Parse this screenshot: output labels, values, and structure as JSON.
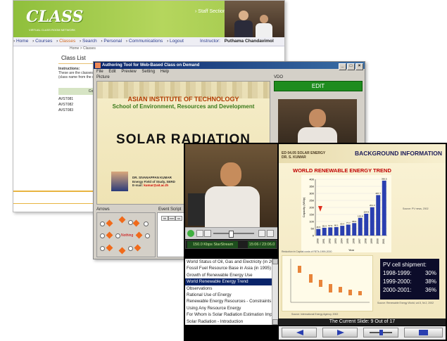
{
  "vclass": {
    "logo": "CLASS",
    "logo_sub": "VIRTUAL CLASS ROOM NETWORK",
    "staff_section": "Staff Section",
    "nav": [
      "Home",
      "Courses",
      "Classes",
      "Search",
      "Personal",
      "Communications",
      "Logout"
    ],
    "active_nav": "Classes",
    "instructor_label": "Instructor:",
    "instructor_name": "Puthama Chandavimol",
    "breadcrumb": "Home > Classes",
    "class_list": "Class List",
    "instructions_label": "Instructions:",
    "instructions_text": [
      "These are the classes ass",
      "(class name from the dro"
    ],
    "course_header": "Course No.",
    "courses": [
      "AVST081",
      "AVST082",
      "AVST083"
    ]
  },
  "authoring": {
    "title": "Authoring Tool for Web-Based Class on Demand",
    "menu": [
      "File",
      "Edit",
      "Preview",
      "Setting",
      "Help"
    ],
    "picture_label": "Picture",
    "vdo_label": "VDO",
    "edit_button": "EDIT",
    "slide": {
      "org": "ASIAN INSTITUTE OF TECHNOLOGY",
      "school": "School of Environment, Resources and Development",
      "title": "SOLAR RADIATION",
      "name": "DR. SIVANAPPAN KUMAR",
      "field": "Energy Field of Study, SERD",
      "email_label": "E-mail:",
      "email": "kumar@ait.ac.th"
    },
    "arrows_label": "Arrows",
    "nothing_label": "Nothing",
    "event_label": "Event Script",
    "event_cols": [
      "hh",
      "mm",
      "ss"
    ]
  },
  "player": {
    "status_bitrate": "150.0 Kbps StarStream",
    "status_time": "15:06 / 23:06.0",
    "slide_list": [
      "World Status of Oil, Gas and Electricity (in 2001)",
      "Fossil Fuel Resource Base in Asia (in 1995)",
      "Growth of Renewable Energy Use",
      "World Renewable Energy Trend",
      "Observations",
      "Rational Use of Energy",
      "Renewable Energy Resources - Constraints",
      "Using Any Resource Energy",
      "For Whom is Solar Radiation Estimation Important",
      "Solar Radiation - Introduction"
    ],
    "selected_index": 3,
    "slide_code": "ED 04.05 SOLAR ENERGY",
    "slide_author": "DR. S. KUMAR",
    "background_info": "BACKGROUND INFORMATION",
    "chart_title": "WORLD RENEWABLE ENERGY TREND",
    "source": "Source: PV news, 2002",
    "chart2_title": "Reduction in Capital costs of RETs 1999-2000",
    "pv_title": "PV cell shipment:",
    "pv_rows": [
      {
        "range": "1998-1999:",
        "value": "30%"
      },
      {
        "range": "1999-2000:",
        "value": "38%"
      },
      {
        "range": "2000-2001:",
        "value": "36%"
      }
    ],
    "pv_source": "Source: Renewable Energy World, vol.5, Nr.2, 2002",
    "chart2_source": "Source: International Energy Agency, 2002",
    "current_slide": "The Current Slide: 9 Out of 17"
  },
  "chart_data": {
    "type": "bar",
    "title": "WORLD RENEWABLE ENERGY TREND",
    "xlabel": "Year",
    "ylabel": "Capacity (MWp)",
    "categories": [
      "1990",
      "1991",
      "1992",
      "1993",
      "1994",
      "1995",
      "1996",
      "1997",
      "1998",
      "1999",
      "2000",
      "2001"
    ],
    "values": [
      46.5,
      55.4,
      57.9,
      60.1,
      69.4,
      77.7,
      88.6,
      125.8,
      154.9,
      201.3,
      287.7,
      390.5
    ],
    "ylim": [
      0,
      400
    ],
    "bar_color": "#2a3fb0"
  }
}
